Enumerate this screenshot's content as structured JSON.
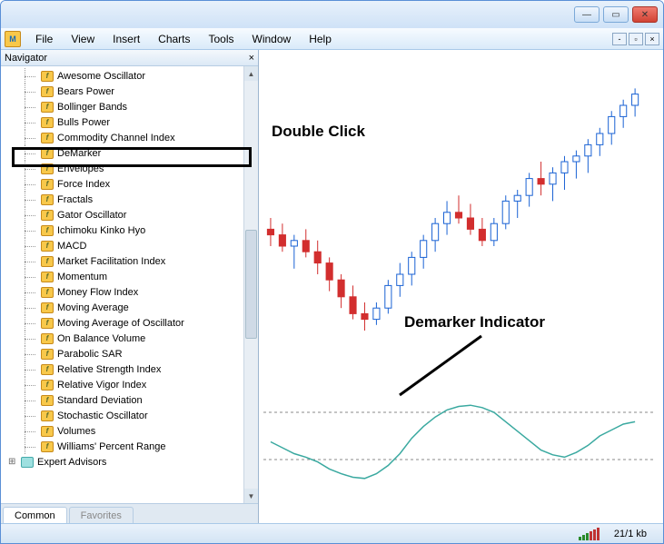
{
  "menu": {
    "items": [
      "File",
      "View",
      "Insert",
      "Charts",
      "Tools",
      "Window",
      "Help"
    ]
  },
  "navigator": {
    "title": "Navigator",
    "items": [
      "Awesome Oscillator",
      "Bears Power",
      "Bollinger Bands",
      "Bulls Power",
      "Commodity Channel Index",
      "DeMarker",
      "Envelopes",
      "Force Index",
      "Fractals",
      "Gator Oscillator",
      "Ichimoku Kinko Hyo",
      "MACD",
      "Market Facilitation Index",
      "Momentum",
      "Money Flow Index",
      "Moving Average",
      "Moving Average of Oscillator",
      "On Balance Volume",
      "Parabolic SAR",
      "Relative Strength Index",
      "Relative Vigor Index",
      "Standard Deviation",
      "Stochastic Oscillator",
      "Volumes",
      "Williams' Percent Range"
    ],
    "root_node": "Expert Advisors",
    "tabs": {
      "common": "Common",
      "favorites": "Favorites"
    }
  },
  "annotations": {
    "double_click": "Double Click",
    "indicator_label": "Demarker Indicator"
  },
  "statusbar": {
    "kb": "21/1 kb"
  },
  "colors": {
    "bull": "#1a62d4",
    "bear": "#d22e2e",
    "indicator_line": "#3aa9a0"
  },
  "chart_data": {
    "type": "candlestick",
    "panels": [
      {
        "name": "price",
        "ylim": [
          0,
          100
        ],
        "candles": [
          {
            "o": 46,
            "h": 50,
            "l": 40,
            "c": 44
          },
          {
            "o": 44,
            "h": 48,
            "l": 38,
            "c": 40
          },
          {
            "o": 40,
            "h": 44,
            "l": 32,
            "c": 42
          },
          {
            "o": 42,
            "h": 46,
            "l": 36,
            "c": 38
          },
          {
            "o": 38,
            "h": 42,
            "l": 30,
            "c": 34
          },
          {
            "o": 34,
            "h": 36,
            "l": 24,
            "c": 28
          },
          {
            "o": 28,
            "h": 30,
            "l": 18,
            "c": 22
          },
          {
            "o": 22,
            "h": 26,
            "l": 14,
            "c": 16
          },
          {
            "o": 16,
            "h": 20,
            "l": 10,
            "c": 14
          },
          {
            "o": 14,
            "h": 20,
            "l": 12,
            "c": 18
          },
          {
            "o": 18,
            "h": 28,
            "l": 16,
            "c": 26
          },
          {
            "o": 26,
            "h": 34,
            "l": 22,
            "c": 30
          },
          {
            "o": 30,
            "h": 38,
            "l": 26,
            "c": 36
          },
          {
            "o": 36,
            "h": 44,
            "l": 32,
            "c": 42
          },
          {
            "o": 42,
            "h": 50,
            "l": 38,
            "c": 48
          },
          {
            "o": 48,
            "h": 56,
            "l": 44,
            "c": 52
          },
          {
            "o": 52,
            "h": 58,
            "l": 48,
            "c": 50
          },
          {
            "o": 50,
            "h": 55,
            "l": 44,
            "c": 46
          },
          {
            "o": 46,
            "h": 50,
            "l": 40,
            "c": 42
          },
          {
            "o": 42,
            "h": 50,
            "l": 40,
            "c": 48
          },
          {
            "o": 48,
            "h": 58,
            "l": 46,
            "c": 56
          },
          {
            "o": 56,
            "h": 60,
            "l": 50,
            "c": 58
          },
          {
            "o": 58,
            "h": 66,
            "l": 54,
            "c": 64
          },
          {
            "o": 64,
            "h": 70,
            "l": 58,
            "c": 62
          },
          {
            "o": 62,
            "h": 68,
            "l": 56,
            "c": 66
          },
          {
            "o": 66,
            "h": 72,
            "l": 60,
            "c": 70
          },
          {
            "o": 70,
            "h": 74,
            "l": 64,
            "c": 72
          },
          {
            "o": 72,
            "h": 78,
            "l": 66,
            "c": 76
          },
          {
            "o": 76,
            "h": 82,
            "l": 72,
            "c": 80
          },
          {
            "o": 80,
            "h": 88,
            "l": 76,
            "c": 86
          },
          {
            "o": 86,
            "h": 92,
            "l": 82,
            "c": 90
          },
          {
            "o": 90,
            "h": 96,
            "l": 86,
            "c": 94
          }
        ]
      },
      {
        "name": "demarker",
        "ylim": [
          0,
          1
        ],
        "guides": [
          0.3,
          0.7
        ],
        "values": [
          0.45,
          0.4,
          0.35,
          0.32,
          0.28,
          0.22,
          0.18,
          0.15,
          0.14,
          0.18,
          0.25,
          0.35,
          0.48,
          0.58,
          0.66,
          0.72,
          0.75,
          0.76,
          0.74,
          0.7,
          0.62,
          0.54,
          0.46,
          0.38,
          0.34,
          0.32,
          0.36,
          0.42,
          0.5,
          0.55,
          0.6,
          0.62
        ]
      }
    ]
  }
}
